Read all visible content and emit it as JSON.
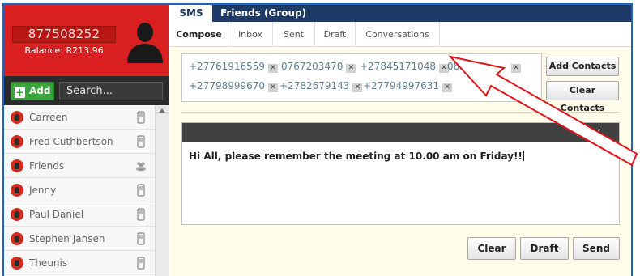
{
  "profile": {
    "phone": "877508252",
    "balance": "Balance: R213.96"
  },
  "sidebar": {
    "add_label": "Add",
    "search_placeholder": "Search...",
    "contacts": [
      {
        "name": "Carreen",
        "type": "phone"
      },
      {
        "name": "Fred Cuthbertson",
        "type": "phone"
      },
      {
        "name": "Friends",
        "type": "group"
      },
      {
        "name": "Jenny",
        "type": "phone"
      },
      {
        "name": "Paul Daniel",
        "type": "phone"
      },
      {
        "name": "Stephen Jansen",
        "type": "phone"
      },
      {
        "name": "Theunis",
        "type": "phone"
      }
    ]
  },
  "tabs": {
    "sms": "SMS",
    "group": "Friends (Group)"
  },
  "subtabs": [
    "Compose",
    "Inbox",
    "Sent",
    "Draft",
    "Conversations"
  ],
  "recipients": [
    "+27761916559",
    "0767203470",
    "+27845171048",
    "0826",
    "+27798999670",
    "+2782679143",
    "+27794997631"
  ],
  "buttons": {
    "add_contacts": "Add Contacts",
    "clear_contacts": "Clear Contacts",
    "clear": "Clear",
    "draft": "Draft",
    "send": "Send"
  },
  "message": {
    "counter": "141/",
    "text": "Hi All, please remember the meeting at 10.00 am on Friday!!"
  },
  "colors": {
    "brand_red": "#d91f1f",
    "tab_navy": "#1d3a66",
    "add_green": "#38a63a",
    "annotation_red": "#e0141a"
  }
}
